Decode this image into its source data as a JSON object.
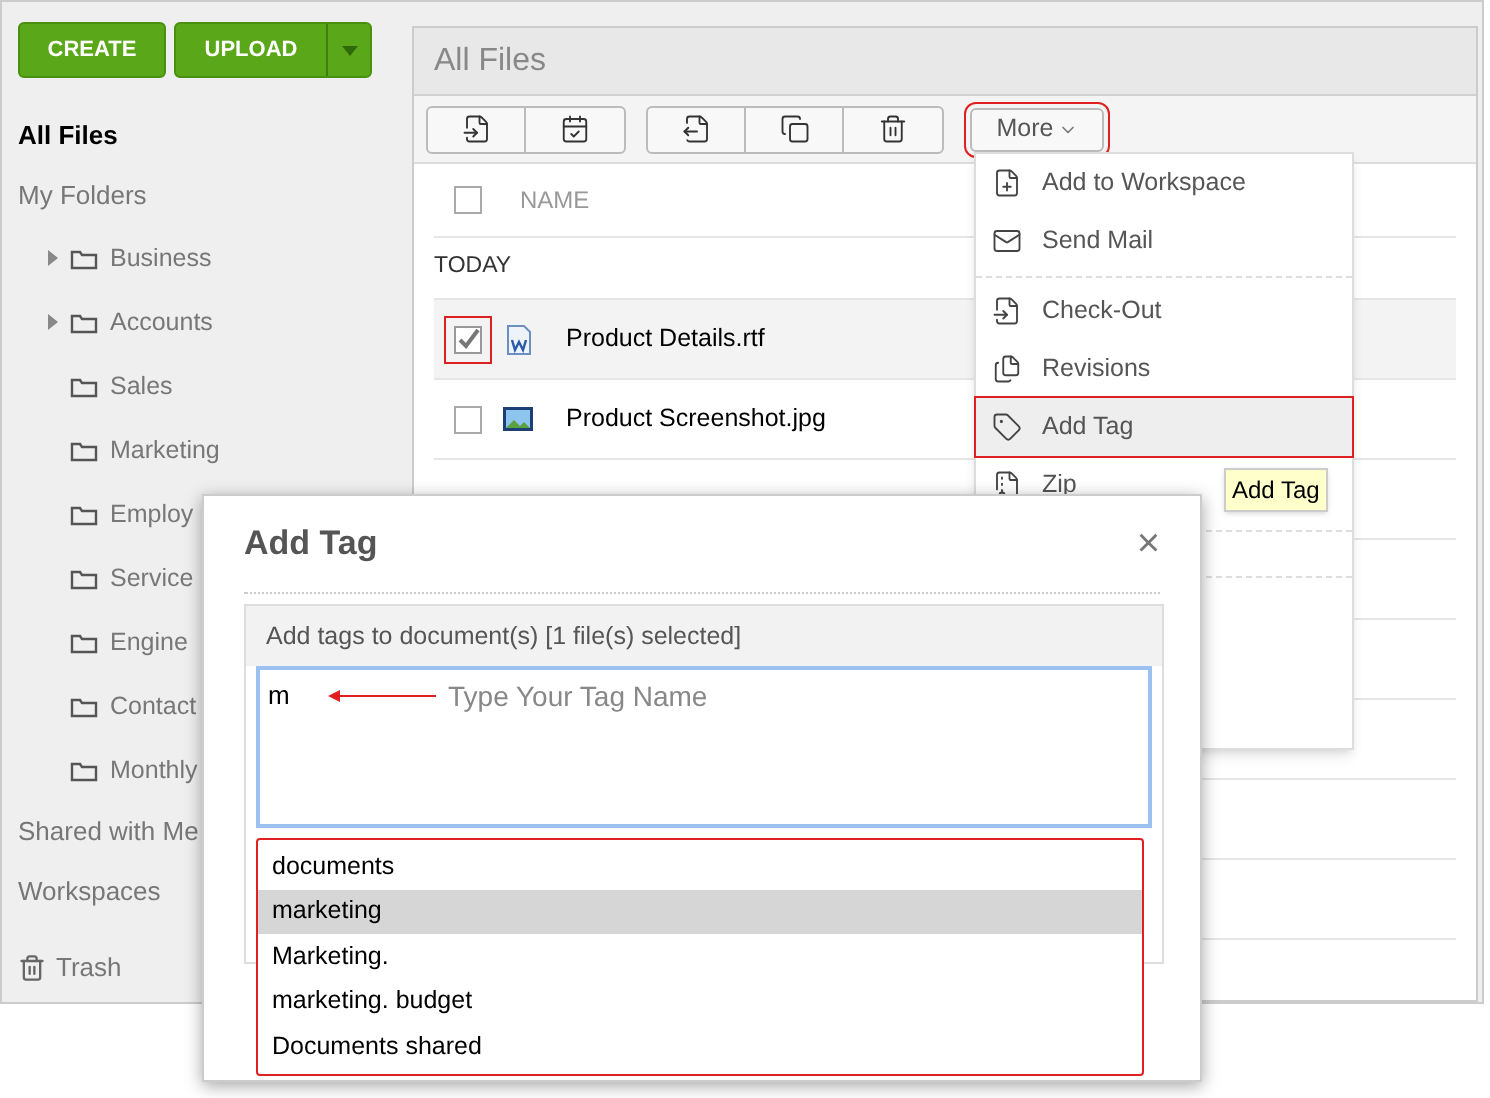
{
  "sidebar": {
    "create_button": "CREATE",
    "upload_button": "UPLOAD",
    "items": [
      {
        "label": "All Files",
        "selected": true,
        "kind": "link"
      },
      {
        "label": "My Folders",
        "selected": false,
        "kind": "link",
        "children": [
          {
            "label": "Business",
            "expandable": true
          },
          {
            "label": "Accounts",
            "expandable": true
          },
          {
            "label": "Sales",
            "expandable": false
          },
          {
            "label": "Marketing",
            "expandable": false
          },
          {
            "label": "Employ",
            "expandable": false
          },
          {
            "label": "Service",
            "expandable": false
          },
          {
            "label": "Engine",
            "expandable": false
          },
          {
            "label": "Contact",
            "expandable": false
          },
          {
            "label": "Monthly",
            "expandable": false
          }
        ]
      },
      {
        "label": "Shared with Me",
        "selected": false,
        "kind": "link"
      },
      {
        "label": "Workspaces",
        "selected": false,
        "kind": "link"
      },
      {
        "label": "Trash",
        "selected": false,
        "kind": "trash"
      }
    ]
  },
  "main": {
    "title": "All Files",
    "more_button": "More",
    "table": {
      "columns": [
        "NAME"
      ],
      "all_checked": false,
      "groups": [
        {
          "label": "TODAY",
          "rows": [
            {
              "name": "Product Details.rtf",
              "kind": "document",
              "checked": true
            },
            {
              "name": "Product Screenshot.jpg",
              "kind": "image",
              "checked": false
            }
          ]
        }
      ]
    }
  },
  "more_menu": {
    "items": [
      {
        "label": "Add to Workspace",
        "kind": "workspace",
        "selected": false,
        "divider_before": false
      },
      {
        "label": "Send Mail",
        "kind": "mail",
        "selected": false,
        "divider_before": false
      },
      {
        "label": "Check-Out",
        "kind": "checkout",
        "selected": false,
        "divider_before": true
      },
      {
        "label": "Revisions",
        "kind": "revisions",
        "selected": false,
        "divider_before": false
      },
      {
        "label": "Add Tag",
        "kind": "tag",
        "selected": true,
        "divider_before": false
      },
      {
        "label": "Zip",
        "kind": "zip",
        "selected": false,
        "divider_before": false
      }
    ],
    "tooltip": "Add Tag"
  },
  "dialog": {
    "title": "Add Tag",
    "close": "×",
    "header": "Add tags to document(s) [1 file(s) selected]",
    "value": "m",
    "annotation": "Type Your Tag Name",
    "suggestions": [
      {
        "label": "documents",
        "selected": false
      },
      {
        "label": "marketing",
        "selected": true
      },
      {
        "label": "Marketing.",
        "selected": false
      },
      {
        "label": "marketing. budget",
        "selected": false
      },
      {
        "label": "Documents shared",
        "selected": false
      }
    ]
  }
}
